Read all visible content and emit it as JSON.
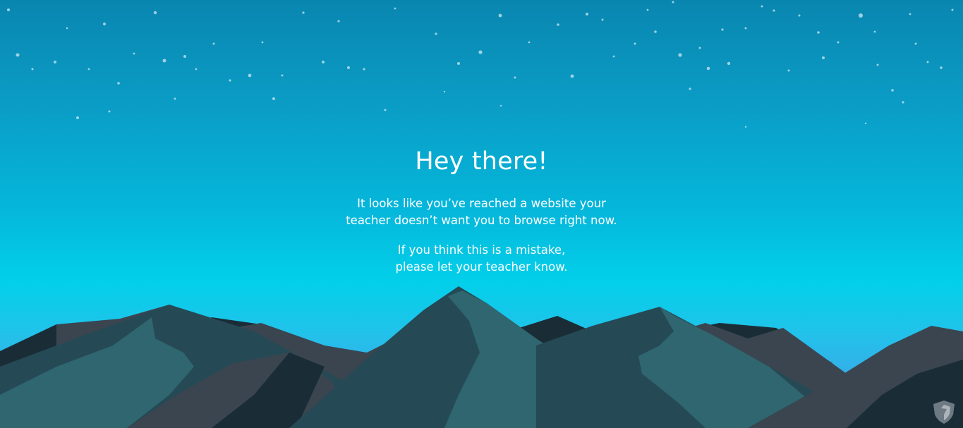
{
  "page": {
    "heading": "Hey there!",
    "message_line1": "It looks like you’ve reached a website your",
    "message_line2": "teacher doesn’t want you to browse right now.",
    "note_line1": "If you think this is a mistake,",
    "note_line2": "please let your teacher know."
  },
  "icons": {
    "brand": "shield-logo-icon"
  },
  "colors": {
    "sky_top": "#0986b0",
    "sky_mid": "#02d0ea",
    "sky_bottom": "#3aa9e8",
    "mountain_dark": "#1a2d36",
    "mountain_mid": "#254a55",
    "mountain_light": "#2f6670",
    "mountain_gray": "#3a4550",
    "text": "#ffffff"
  }
}
